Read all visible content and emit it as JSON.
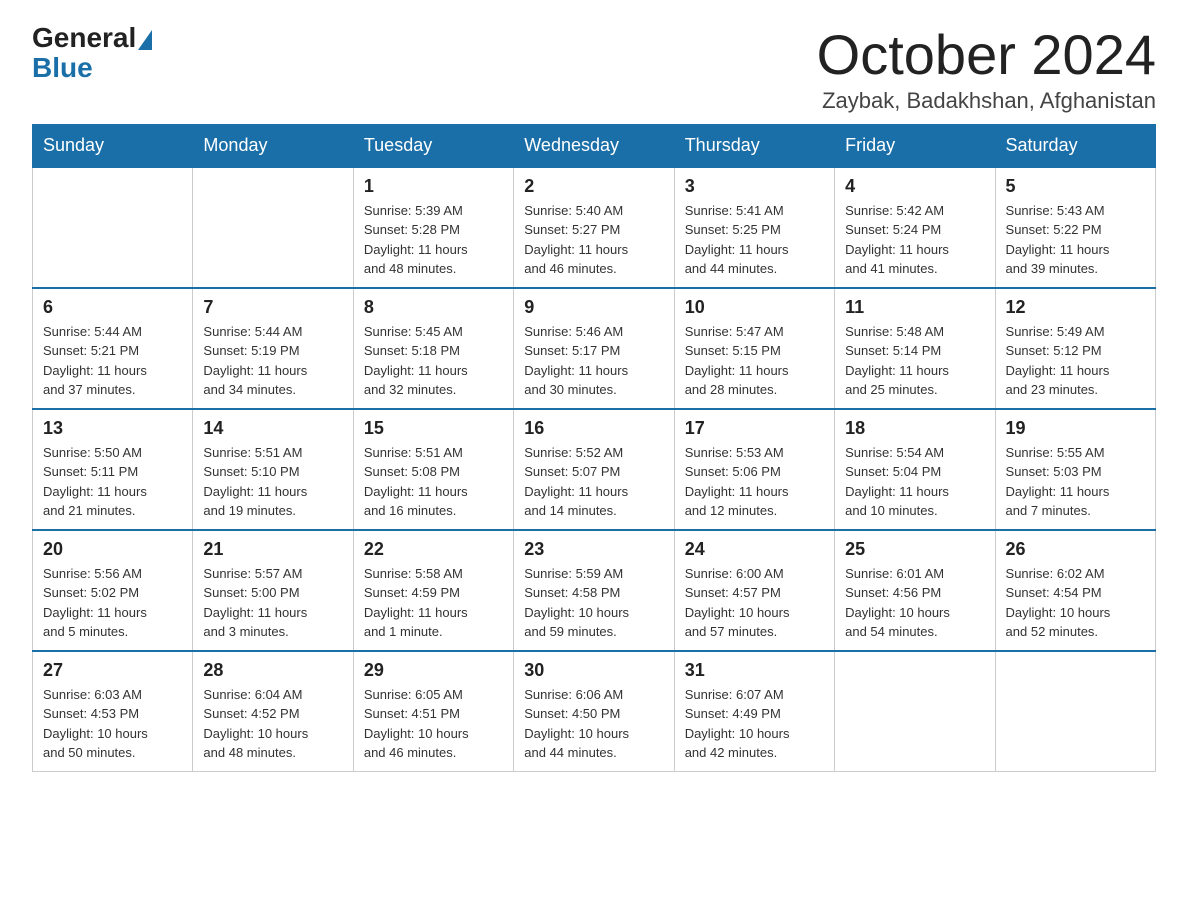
{
  "header": {
    "logo_general": "General",
    "logo_blue": "Blue",
    "month_title": "October 2024",
    "location": "Zaybak, Badakhshan, Afghanistan"
  },
  "weekdays": [
    "Sunday",
    "Monday",
    "Tuesday",
    "Wednesday",
    "Thursday",
    "Friday",
    "Saturday"
  ],
  "weeks": [
    [
      {
        "day": "",
        "info": ""
      },
      {
        "day": "",
        "info": ""
      },
      {
        "day": "1",
        "info": "Sunrise: 5:39 AM\nSunset: 5:28 PM\nDaylight: 11 hours\nand 48 minutes."
      },
      {
        "day": "2",
        "info": "Sunrise: 5:40 AM\nSunset: 5:27 PM\nDaylight: 11 hours\nand 46 minutes."
      },
      {
        "day": "3",
        "info": "Sunrise: 5:41 AM\nSunset: 5:25 PM\nDaylight: 11 hours\nand 44 minutes."
      },
      {
        "day": "4",
        "info": "Sunrise: 5:42 AM\nSunset: 5:24 PM\nDaylight: 11 hours\nand 41 minutes."
      },
      {
        "day": "5",
        "info": "Sunrise: 5:43 AM\nSunset: 5:22 PM\nDaylight: 11 hours\nand 39 minutes."
      }
    ],
    [
      {
        "day": "6",
        "info": "Sunrise: 5:44 AM\nSunset: 5:21 PM\nDaylight: 11 hours\nand 37 minutes."
      },
      {
        "day": "7",
        "info": "Sunrise: 5:44 AM\nSunset: 5:19 PM\nDaylight: 11 hours\nand 34 minutes."
      },
      {
        "day": "8",
        "info": "Sunrise: 5:45 AM\nSunset: 5:18 PM\nDaylight: 11 hours\nand 32 minutes."
      },
      {
        "day": "9",
        "info": "Sunrise: 5:46 AM\nSunset: 5:17 PM\nDaylight: 11 hours\nand 30 minutes."
      },
      {
        "day": "10",
        "info": "Sunrise: 5:47 AM\nSunset: 5:15 PM\nDaylight: 11 hours\nand 28 minutes."
      },
      {
        "day": "11",
        "info": "Sunrise: 5:48 AM\nSunset: 5:14 PM\nDaylight: 11 hours\nand 25 minutes."
      },
      {
        "day": "12",
        "info": "Sunrise: 5:49 AM\nSunset: 5:12 PM\nDaylight: 11 hours\nand 23 minutes."
      }
    ],
    [
      {
        "day": "13",
        "info": "Sunrise: 5:50 AM\nSunset: 5:11 PM\nDaylight: 11 hours\nand 21 minutes."
      },
      {
        "day": "14",
        "info": "Sunrise: 5:51 AM\nSunset: 5:10 PM\nDaylight: 11 hours\nand 19 minutes."
      },
      {
        "day": "15",
        "info": "Sunrise: 5:51 AM\nSunset: 5:08 PM\nDaylight: 11 hours\nand 16 minutes."
      },
      {
        "day": "16",
        "info": "Sunrise: 5:52 AM\nSunset: 5:07 PM\nDaylight: 11 hours\nand 14 minutes."
      },
      {
        "day": "17",
        "info": "Sunrise: 5:53 AM\nSunset: 5:06 PM\nDaylight: 11 hours\nand 12 minutes."
      },
      {
        "day": "18",
        "info": "Sunrise: 5:54 AM\nSunset: 5:04 PM\nDaylight: 11 hours\nand 10 minutes."
      },
      {
        "day": "19",
        "info": "Sunrise: 5:55 AM\nSunset: 5:03 PM\nDaylight: 11 hours\nand 7 minutes."
      }
    ],
    [
      {
        "day": "20",
        "info": "Sunrise: 5:56 AM\nSunset: 5:02 PM\nDaylight: 11 hours\nand 5 minutes."
      },
      {
        "day": "21",
        "info": "Sunrise: 5:57 AM\nSunset: 5:00 PM\nDaylight: 11 hours\nand 3 minutes."
      },
      {
        "day": "22",
        "info": "Sunrise: 5:58 AM\nSunset: 4:59 PM\nDaylight: 11 hours\nand 1 minute."
      },
      {
        "day": "23",
        "info": "Sunrise: 5:59 AM\nSunset: 4:58 PM\nDaylight: 10 hours\nand 59 minutes."
      },
      {
        "day": "24",
        "info": "Sunrise: 6:00 AM\nSunset: 4:57 PM\nDaylight: 10 hours\nand 57 minutes."
      },
      {
        "day": "25",
        "info": "Sunrise: 6:01 AM\nSunset: 4:56 PM\nDaylight: 10 hours\nand 54 minutes."
      },
      {
        "day": "26",
        "info": "Sunrise: 6:02 AM\nSunset: 4:54 PM\nDaylight: 10 hours\nand 52 minutes."
      }
    ],
    [
      {
        "day": "27",
        "info": "Sunrise: 6:03 AM\nSunset: 4:53 PM\nDaylight: 10 hours\nand 50 minutes."
      },
      {
        "day": "28",
        "info": "Sunrise: 6:04 AM\nSunset: 4:52 PM\nDaylight: 10 hours\nand 48 minutes."
      },
      {
        "day": "29",
        "info": "Sunrise: 6:05 AM\nSunset: 4:51 PM\nDaylight: 10 hours\nand 46 minutes."
      },
      {
        "day": "30",
        "info": "Sunrise: 6:06 AM\nSunset: 4:50 PM\nDaylight: 10 hours\nand 44 minutes."
      },
      {
        "day": "31",
        "info": "Sunrise: 6:07 AM\nSunset: 4:49 PM\nDaylight: 10 hours\nand 42 minutes."
      },
      {
        "day": "",
        "info": ""
      },
      {
        "day": "",
        "info": ""
      }
    ]
  ]
}
